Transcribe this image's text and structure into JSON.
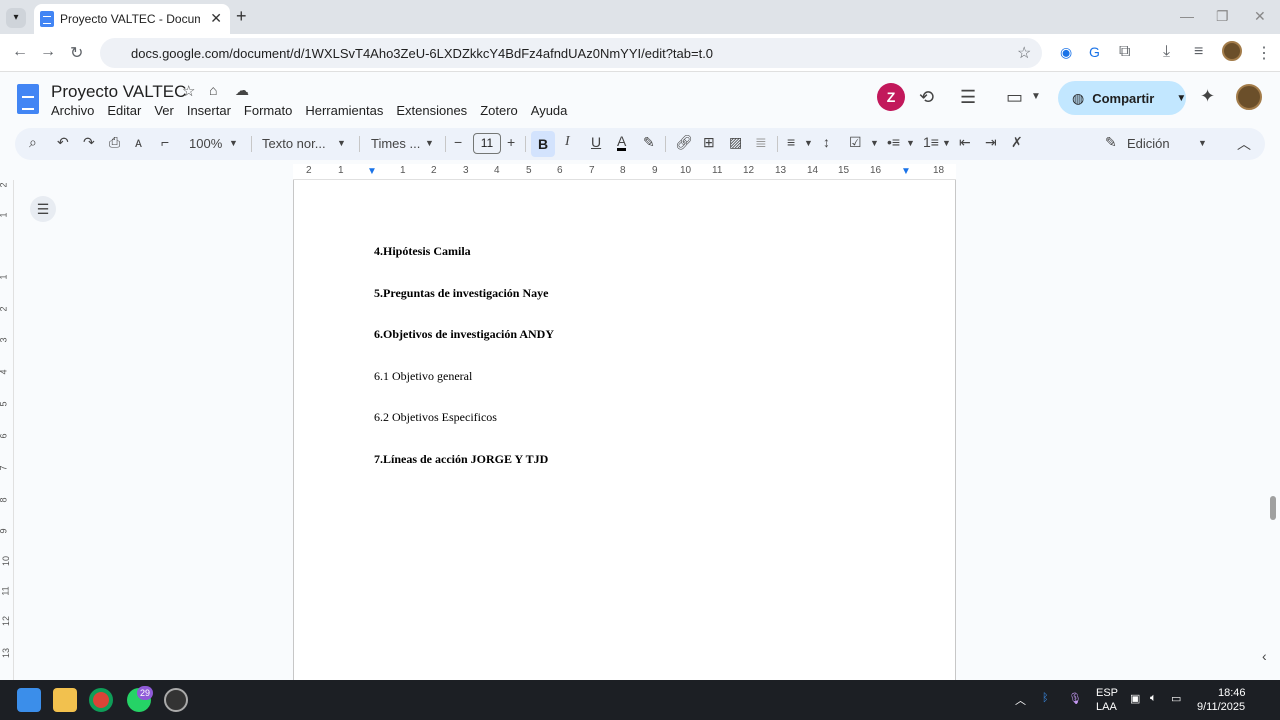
{
  "browser": {
    "tab_title": "Proyecto VALTEC - Documentos",
    "tab_close": "✕",
    "new_tab": "+",
    "url": "docs.google.com/document/d/1WXLSvT4Aho3ZeU-6LXDZkkcY4BdFz4afndUAz0NmYYI/edit?tab=t.0"
  },
  "docs": {
    "title": "Proyecto VALTEC",
    "menu": [
      "Archivo",
      "Editar",
      "Ver",
      "Insertar",
      "Formato",
      "Herramientas",
      "Extensiones",
      "Zotero",
      "Ayuda"
    ],
    "share_label": "Compartir"
  },
  "toolbar": {
    "zoom": "100%",
    "style": "Texto nor...",
    "font": "Times ...",
    "font_size": "11",
    "bold": "B",
    "italic": "I",
    "underline": "U",
    "text_color": "A",
    "mode": "Edición"
  },
  "ruler": {
    "numbers": [
      "2",
      "1",
      "1",
      "2",
      "3",
      "4",
      "5",
      "6",
      "7",
      "8",
      "9",
      "10",
      "11",
      "12",
      "13",
      "14",
      "15",
      "16",
      "17",
      "18"
    ]
  },
  "vertical_ruler": [
    "2",
    "1",
    "1",
    "2",
    "3",
    "4",
    "5",
    "6",
    "7",
    "8",
    "9",
    "10",
    "11",
    "12",
    "13"
  ],
  "document": {
    "lines": [
      {
        "text": "4.Hipótesis Camila",
        "bold": true
      },
      {
        "text": "5.Preguntas de investigación Naye",
        "bold": true
      },
      {
        "text": "6.Objetivos de investigación ANDY",
        "bold": true
      },
      {
        "text": "6.1 Objetivo general",
        "bold": false
      },
      {
        "text": "6.2 Objetivos Especificos",
        "bold": false
      },
      {
        "text": "7.Líneas de acción JORGE Y TJD",
        "bold": true
      }
    ]
  },
  "taskbar": {
    "whatsapp_badge": "29",
    "lang": "ESP",
    "lang_sub": "LAA",
    "time": "18:46",
    "date": "9/11/2025"
  },
  "colors": {
    "accent": "#1a73e8",
    "share_bg": "#c2e7ff",
    "bold_active_bg": "#d3e3fd"
  }
}
